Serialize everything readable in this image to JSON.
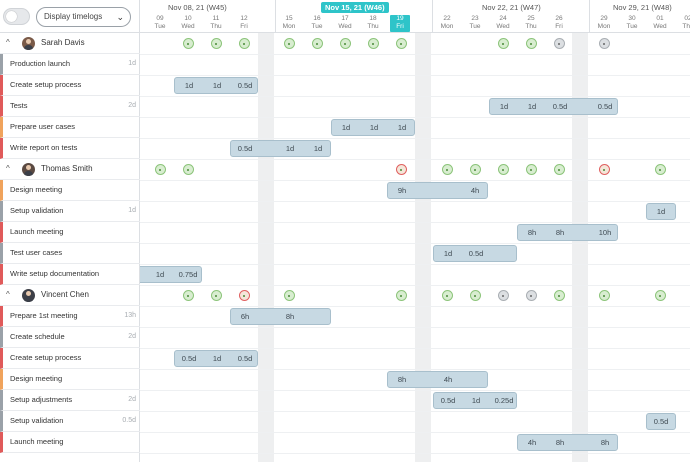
{
  "toolbar": {
    "select_value": "Display timelogs"
  },
  "weeks": [
    {
      "label": "Nov 08, 21 (W45)",
      "current": false
    },
    {
      "label": "Nov 15, 21 (W46)",
      "current": true
    },
    {
      "label": "Nov 22, 21 (W47)",
      "current": false
    },
    {
      "label": "Nov 29, 21 (W48)",
      "current": false
    }
  ],
  "days": [
    {
      "num": "09",
      "dow": "Tue"
    },
    {
      "num": "10",
      "dow": "Wed"
    },
    {
      "num": "11",
      "dow": "Thu"
    },
    {
      "num": "12",
      "dow": "Fri"
    },
    {
      "num": "15",
      "dow": "Mon"
    },
    {
      "num": "16",
      "dow": "Tue"
    },
    {
      "num": "17",
      "dow": "Wed"
    },
    {
      "num": "18",
      "dow": "Thu"
    },
    {
      "num": "19",
      "dow": "Fri",
      "today": true
    },
    {
      "num": "22",
      "dow": "Mon"
    },
    {
      "num": "23",
      "dow": "Tue"
    },
    {
      "num": "24",
      "dow": "Wed"
    },
    {
      "num": "25",
      "dow": "Thu"
    },
    {
      "num": "26",
      "dow": "Fri"
    },
    {
      "num": "29",
      "dow": "Mon"
    },
    {
      "num": "30",
      "dow": "Tue"
    },
    {
      "num": "01",
      "dow": "Wed"
    },
    {
      "num": "02",
      "dow": "Thu"
    }
  ],
  "people": [
    {
      "name": "Sarah Davis",
      "tasks": [
        {
          "name": "Production launch",
          "estimate": "1d",
          "color": "#9aa1a8"
        },
        {
          "name": "Create setup process",
          "estimate": "",
          "color": "#e05a5a",
          "labels": [
            "1d",
            "1d",
            "0.5d"
          ]
        },
        {
          "name": "Tests",
          "estimate": "2d",
          "color": "#e05a5a",
          "labels": [
            "1d",
            "1d",
            "0.5d",
            "0.5d"
          ]
        },
        {
          "name": "Prepare user cases",
          "estimate": "",
          "color": "#f0a35c",
          "labels": [
            "1d",
            "1d",
            "1d"
          ]
        },
        {
          "name": "Write report on tests",
          "estimate": "",
          "color": "#e05a5a",
          "labels": [
            "0.5d",
            "1d",
            "1d"
          ]
        }
      ]
    },
    {
      "name": "Thomas Smith",
      "tasks": [
        {
          "name": "Design meeting",
          "estimate": "",
          "color": "#f0a35c",
          "labels": [
            "9h",
            "4h"
          ]
        },
        {
          "name": "Setup validation",
          "estimate": "1d",
          "color": "#9aa1a8",
          "labels": [
            "1d"
          ]
        },
        {
          "name": "Launch meeting",
          "estimate": "",
          "color": "#e05a5a",
          "labels": [
            "8h",
            "8h",
            "10h"
          ]
        },
        {
          "name": "Test user cases",
          "estimate": "",
          "color": "#9aa1a8",
          "labels": [
            "1d",
            "0.5d"
          ]
        },
        {
          "name": "Write setup documentation",
          "estimate": "",
          "color": "#e05a5a",
          "labels": [
            "1d",
            "0.75d"
          ]
        }
      ]
    },
    {
      "name": "Vincent Chen",
      "tasks": [
        {
          "name": "Prepare 1st meeting",
          "estimate": "13h",
          "color": "#e05a5a",
          "labels": [
            "6h",
            "8h"
          ]
        },
        {
          "name": "Create schedule",
          "estimate": "2d",
          "color": "#9aa1a8"
        },
        {
          "name": "Create setup process",
          "estimate": "",
          "color": "#e05a5a",
          "labels": [
            "0.5d",
            "1d",
            "0.5d"
          ]
        },
        {
          "name": "Design meeting",
          "estimate": "",
          "color": "#f0a35c",
          "labels": [
            "8h",
            "4h"
          ]
        },
        {
          "name": "Setup adjustments",
          "estimate": "2d",
          "color": "#9aa1a8",
          "labels": [
            "0.5d",
            "1d",
            "0.25d"
          ]
        },
        {
          "name": "Setup validation",
          "estimate": "0.5d",
          "color": "#9aa1a8",
          "labels": [
            "0.5d"
          ]
        },
        {
          "name": "Launch meeting",
          "estimate": "",
          "color": "#e05a5a",
          "labels": [
            "4h",
            "8h",
            "8h"
          ]
        }
      ]
    }
  ]
}
